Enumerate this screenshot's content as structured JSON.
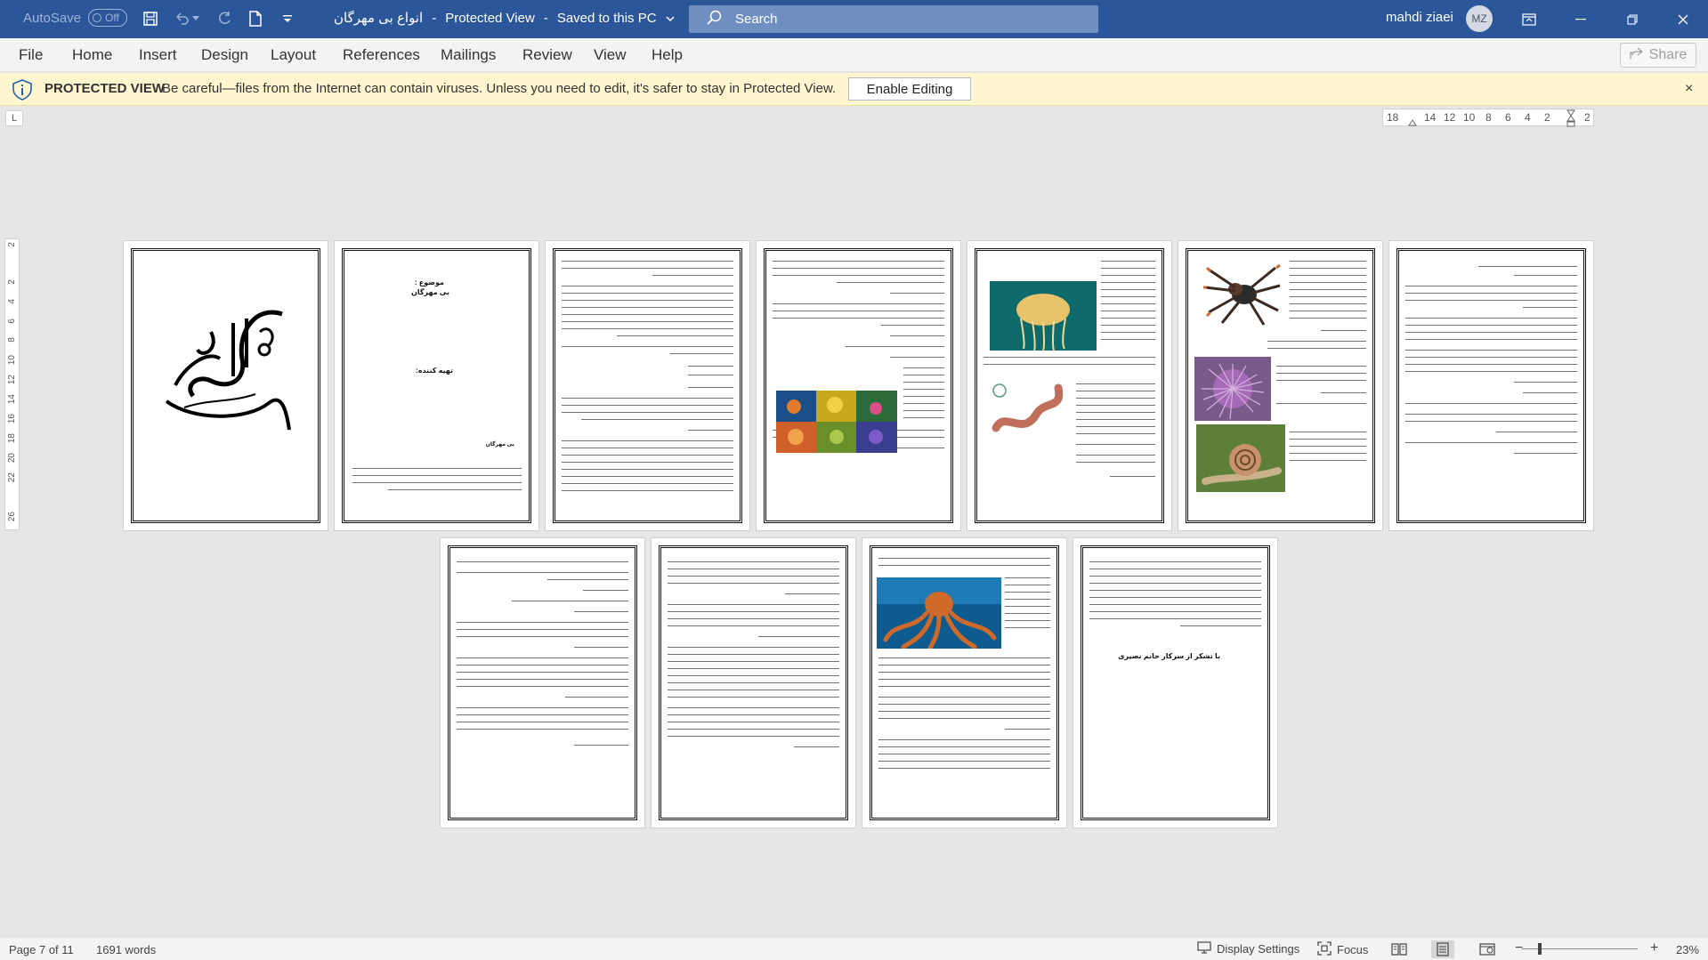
{
  "titlebar": {
    "autosave_label": "AutoSave",
    "autosave_state": "Off",
    "doc_name": "انواع بی مهرگان",
    "separator": "-",
    "view_mode": "Protected View",
    "separator2": "-",
    "save_status": "Saved to this PC",
    "search_placeholder": "Search",
    "user_name": "mahdi ziaei",
    "user_initials": "MZ"
  },
  "menu": {
    "items": [
      "File",
      "Home",
      "Insert",
      "Design",
      "Layout",
      "References",
      "Mailings",
      "Review",
      "View",
      "Help"
    ],
    "share_label": "Share"
  },
  "protected_view": {
    "title": "PROTECTED VIEW",
    "message": "Be careful—files from the Internet can contain viruses. Unless you need to edit, it's safer to stay in Protected View.",
    "button_label": "Enable Editing",
    "close_glyph": "×"
  },
  "ruler": {
    "corner_glyph": "L",
    "horizontal_ticks": [
      "18",
      "14",
      "12",
      "10",
      "8",
      "6",
      "4",
      "2",
      "2"
    ],
    "vertical_ticks": [
      "2",
      "2",
      "4",
      "6",
      "8",
      "10",
      "12",
      "14",
      "16",
      "18",
      "20",
      "22",
      "26"
    ]
  },
  "pages": {
    "page2_title_line1": "موضوع :",
    "page2_title_line2": "بی مهرگان",
    "page2_author": "تهیه کننده:",
    "page2_footer": "بی مهرگان",
    "page11_closing": "با تشکر از سرکار خانم نصیری"
  },
  "status": {
    "page_info": "Page 7 of 11",
    "word_count": "1691 words",
    "display_settings": "Display Settings",
    "focus": "Focus",
    "zoom": "23%"
  },
  "colors": {
    "titlebar": "#2b579a",
    "protected_bar": "#fef6cf",
    "canvas": "#e6e6e6"
  }
}
